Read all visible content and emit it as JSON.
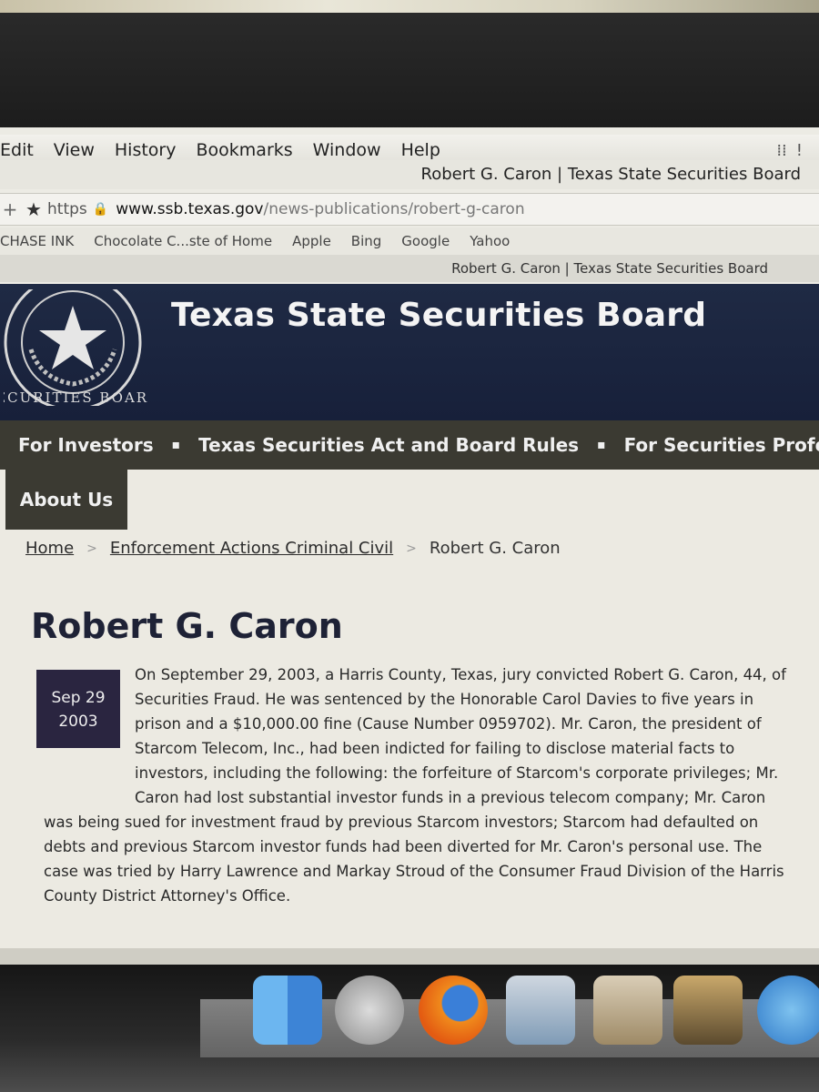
{
  "browser": {
    "menu": [
      "Edit",
      "View",
      "History",
      "Bookmarks",
      "Window",
      "Help"
    ],
    "window_title": "Robert G. Caron | Texas State Securities Board",
    "url": {
      "scheme": "https",
      "host": "www.ssb.texas.gov",
      "path": "/news-publications/robert-g-caron"
    },
    "bookmarks": [
      "CHASE INK",
      "Chocolate C...ste of Home",
      "Apple",
      "Bing",
      "Google",
      "Yahoo"
    ],
    "tab_title": "Robert G. Caron | Texas State Securities Board"
  },
  "site": {
    "seal_text": "SECURITIES BOARD",
    "title": "Texas State Securities Board",
    "nav": [
      "For Investors",
      "Texas Securities Act and Board Rules",
      "For Securities Professio"
    ],
    "nav_separator": "▪",
    "subnav": "About Us"
  },
  "breadcrumb": {
    "home": "Home",
    "section": "Enforcement Actions Criminal Civil",
    "current": "Robert G. Caron",
    "separator": ">"
  },
  "article": {
    "title": "Robert G. Caron",
    "date_month_day": "Sep 29",
    "date_year": "2003",
    "body": "On September 29, 2003, a Harris County, Texas, jury convicted Robert G. Caron, 44, of Securities Fraud. He was sentenced by the Honorable Carol Davies to five years in prison and a $10,000.00 fine (Cause Number 0959702). Mr. Caron, the president of Starcom Telecom, Inc., had been indicted for failing to disclose material facts to investors, including the following: the forfeiture of Starcom's corporate privileges; Mr. Caron had lost substantial investor funds in a previous telecom company; Mr. Caron was being sued for investment fraud by previous Starcom investors; Starcom had defaulted on debts and previous Starcom investor funds had been diverted for Mr. Caron's personal use. The case was tried by Harry Lawrence and Markay Stroud of the Consumer Fraud Division of the Harris County District Attorney's Office."
  },
  "colors": {
    "header_bg": "#1f2a44",
    "nav_bg": "#3b3a32",
    "date_badge_bg": "#2a2540",
    "title_color": "#1e2236"
  }
}
